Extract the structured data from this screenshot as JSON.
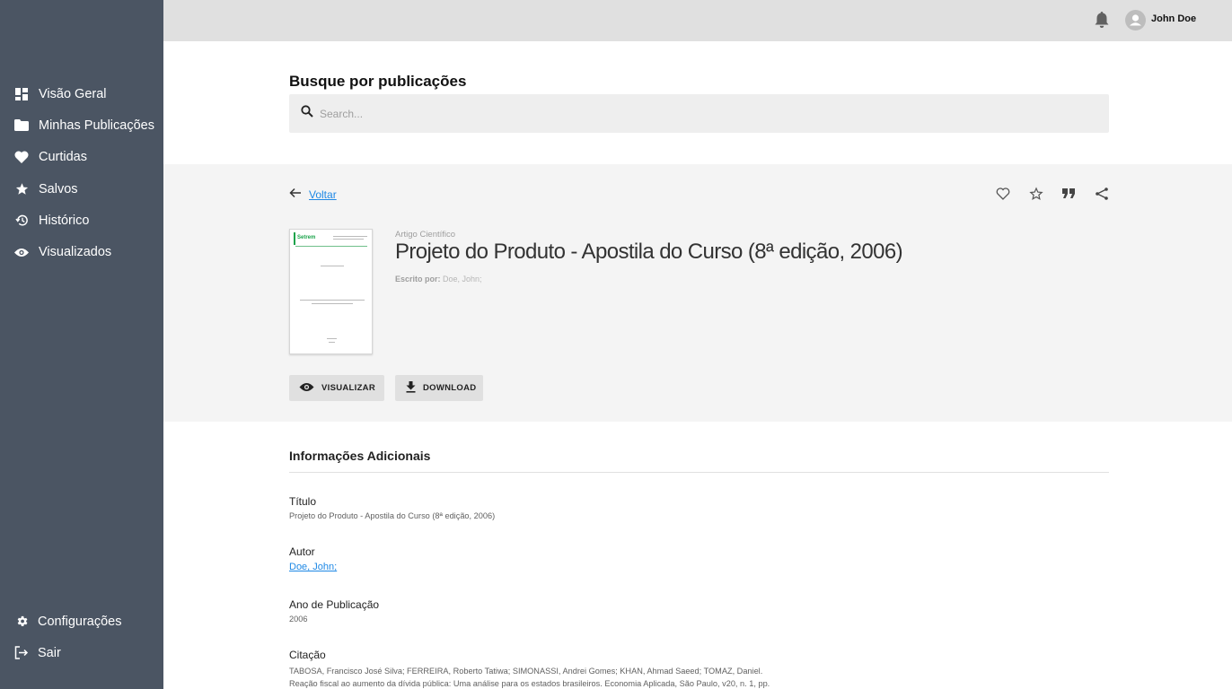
{
  "sidebar": {
    "items": [
      {
        "label": "Visão Geral",
        "icon": "dashboard-icon"
      },
      {
        "label": "Minhas Publicações",
        "icon": "folder-icon"
      },
      {
        "label": "Curtidas",
        "icon": "heart-icon"
      },
      {
        "label": "Salvos",
        "icon": "star-icon"
      },
      {
        "label": "Histórico",
        "icon": "history-icon"
      },
      {
        "label": "Visualizados",
        "icon": "eye-icon"
      }
    ],
    "bottom": [
      {
        "label": "Configurações",
        "icon": "gear-icon"
      },
      {
        "label": "Sair",
        "icon": "logout-icon"
      }
    ]
  },
  "header": {
    "username": "John Doe"
  },
  "search": {
    "title": "Busque por publicações",
    "placeholder": "Search..."
  },
  "publication": {
    "back_label": "Voltar",
    "type": "Artigo Científico",
    "title": "Projeto do Produto - Apostila do Curso (8ª edição, 2006)",
    "author_label": "Escrito por:",
    "author_value": "Doe, John;",
    "thumbnail_brand": "Setrem",
    "view_button": "VISUALIZAR",
    "download_button": "DOWNLOAD"
  },
  "info": {
    "section_title": "Informações Adicionais",
    "fields": {
      "title_label": "Título",
      "title_value": "Projeto do Produto - Apostila do Curso (8ª edição, 2006)",
      "author_label": "Autor",
      "author_value": "Doe, John;",
      "year_label": "Ano de Publicação",
      "year_value": "2006",
      "citation_label": "Citação",
      "citation_line1": "TABOSA, Francisco José Silva; FERREIRA, Roberto Tatiwa; SIMONASSI, Andrei Gomes; KHAN, Ahmad Saeed; TOMAZ, Daniel.",
      "citation_line2": "Reação fiscal ao aumento da dívida pública: Uma análise para os estados brasileiros. Economia Aplicada, São Paulo, v20, n. 1, pp."
    }
  },
  "colors": {
    "sidebar_bg": "#4b5563",
    "topbar_bg": "#e0e0e0",
    "panel_bg": "#f4f4f4",
    "link": "#1e88e5"
  }
}
